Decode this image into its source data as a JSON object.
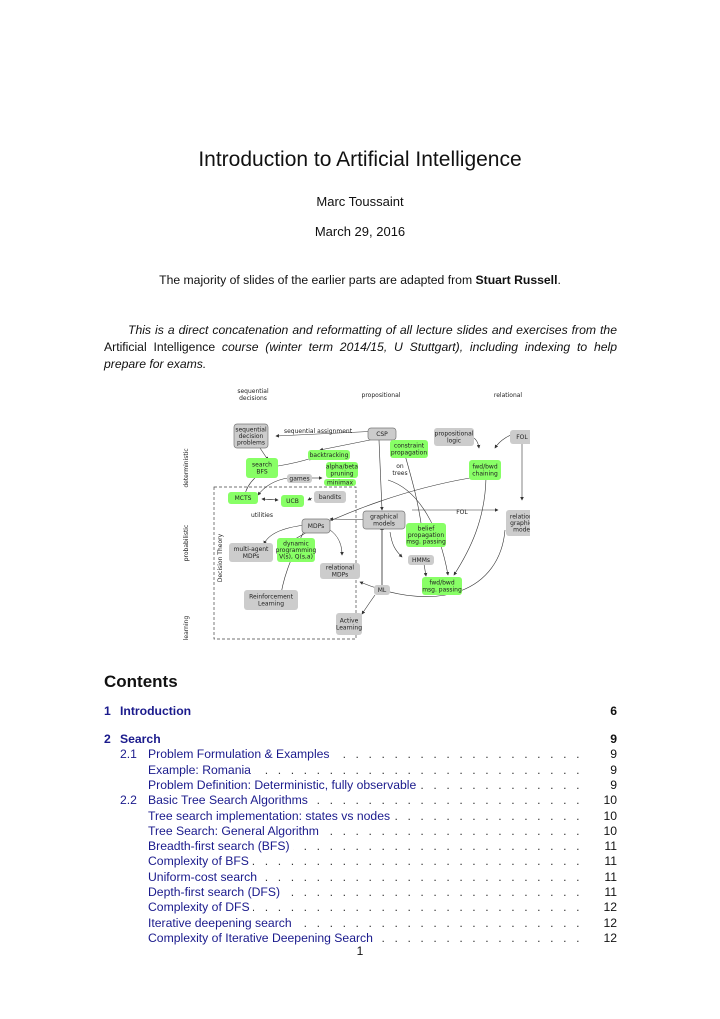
{
  "document": {
    "title": "Introduction to Artificial Intelligence",
    "author": "Marc Toussaint",
    "date": "March 29, 2016",
    "credit_prefix": "The majority of slides of the earlier parts are adapted from ",
    "credit_name": "Stuart Russell",
    "credit_suffix": ".",
    "abstract_part1": "This is a direct concatenation and reformatting of all lecture slides and exercises from the ",
    "abstract_course": "Artificial Intelligence",
    "abstract_part2": " course (winter term 2014/15, U Stuttgart), including indexing to help prepare for exams.",
    "page_number": "1"
  },
  "diagram": {
    "column_headers": [
      "sequential decisions",
      "propositional",
      "relational"
    ],
    "row_labels": [
      "deterministic",
      "probabilistic",
      "learning"
    ],
    "region_label": "Decision Theory",
    "colors": {
      "green": "#88ff66",
      "gray": "#cccccc",
      "dark_gray_border": "#777777"
    },
    "nodes": {
      "seq_decision": "sequential decision problems",
      "csp": "CSP",
      "prop_logic": "propositional logic",
      "fol": "FOL",
      "constraint_prop": "constraint propagation",
      "backtracking": "backtracking",
      "search_bfs": "search BFS",
      "alpha_beta": "alpha/beta pruning",
      "minimax": "minimax",
      "games": "games",
      "fwd_bwd_chaining": "fwd/bwd chaining",
      "mcts": "MCTS",
      "ucb": "UCB",
      "bandits": "bandits",
      "mdps": "MDPs",
      "dyn_prog": "dynamic programming V(s), Q(s,a)",
      "multi_agent": "multi-agent MDPs",
      "relational_mdps": "relational MDPs",
      "rl": "Reinforcement Learning",
      "active_learning": "Active Learning",
      "graphical_models": "graphical models",
      "belief_prop": "belief propagation msg. passing",
      "hmms": "HMMs",
      "fwd_bwd_msg": "fwd/bwd msg. passing",
      "ml": "ML",
      "rel_graphical": "relational graphical models"
    },
    "edge_labels": {
      "seq_assign": "sequential assignment",
      "on_trees": "on trees",
      "fol_edge": "FOL",
      "utilities": "utilities"
    }
  },
  "contents": {
    "heading": "Contents",
    "entries": [
      {
        "level": 0,
        "num": "1",
        "text": "Introduction",
        "page": "6"
      },
      {
        "level": 0,
        "num": "2",
        "text": "Search",
        "page": "9"
      },
      {
        "level": 1,
        "num": "2.1",
        "text": "Problem Formulation & Examples",
        "page": "9"
      },
      {
        "level": 2,
        "num": "",
        "text": "Example: Romania",
        "page": "9"
      },
      {
        "level": 2,
        "num": "",
        "text": "Problem Definition: Deterministic, fully observable",
        "page": "9"
      },
      {
        "level": 1,
        "num": "2.2",
        "text": "Basic Tree Search Algorithms",
        "page": "10"
      },
      {
        "level": 2,
        "num": "",
        "text": "Tree search implementation: states vs nodes",
        "page": "10"
      },
      {
        "level": 2,
        "num": "",
        "text": "Tree Search: General Algorithm",
        "page": "10"
      },
      {
        "level": 2,
        "num": "",
        "text": "Breadth-first search (BFS)",
        "page": "11"
      },
      {
        "level": 2,
        "num": "",
        "text": "Complexity of BFS",
        "page": "11"
      },
      {
        "level": 2,
        "num": "",
        "text": "Uniform-cost search",
        "page": "11"
      },
      {
        "level": 2,
        "num": "",
        "text": "Depth-first search (DFS)",
        "page": "11"
      },
      {
        "level": 2,
        "num": "",
        "text": "Complexity of DFS",
        "page": "12"
      },
      {
        "level": 2,
        "num": "",
        "text": "Iterative deepening search",
        "page": "12"
      },
      {
        "level": 2,
        "num": "",
        "text": "Complexity of Iterative Deepening Search",
        "page": "12"
      }
    ]
  }
}
